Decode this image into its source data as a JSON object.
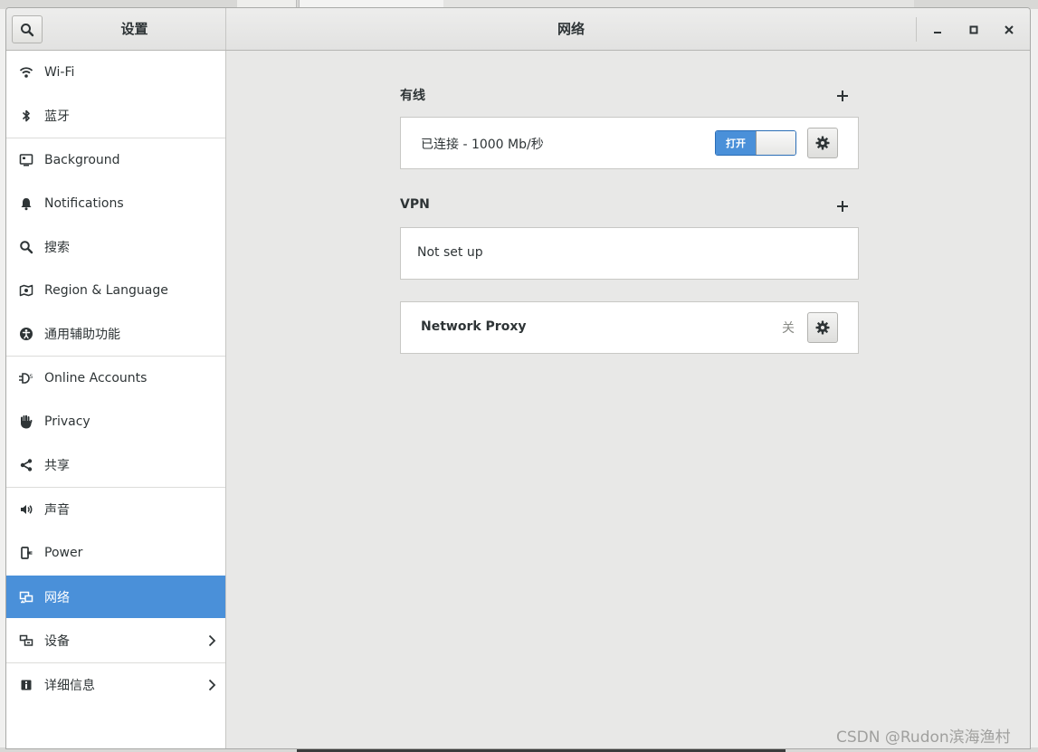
{
  "window": {
    "sidebar_title": "设置",
    "panel_title": "网络"
  },
  "sidebar": {
    "items": [
      {
        "label": "Wi-Fi",
        "icon": "wifi-icon"
      },
      {
        "label": "蓝牙",
        "icon": "bluetooth-icon"
      },
      {
        "label": "Background",
        "icon": "background-icon"
      },
      {
        "label": "Notifications",
        "icon": "bell-icon"
      },
      {
        "label": "搜索",
        "icon": "search-icon"
      },
      {
        "label": "Region & Language",
        "icon": "region-icon"
      },
      {
        "label": "通用辅助功能",
        "icon": "accessibility-icon"
      },
      {
        "label": "Online Accounts",
        "icon": "online-accounts-icon"
      },
      {
        "label": "Privacy",
        "icon": "hand-icon"
      },
      {
        "label": "共享",
        "icon": "share-icon"
      },
      {
        "label": "声音",
        "icon": "speaker-icon"
      },
      {
        "label": "Power",
        "icon": "power-plug-icon"
      },
      {
        "label": "网络",
        "icon": "network-icon",
        "selected": true
      },
      {
        "label": "设备",
        "icon": "devices-icon",
        "has_submenu": true
      },
      {
        "label": "详细信息",
        "icon": "info-icon",
        "has_submenu": true
      }
    ]
  },
  "wired": {
    "title": "有线",
    "status": "已连接 - 1000 Mb/秒",
    "toggle_label": "打开",
    "toggle_on": true
  },
  "vpn": {
    "title": "VPN",
    "empty_text": "Not set up"
  },
  "proxy": {
    "label": "Network Proxy",
    "state": "关"
  },
  "watermark": "CSDN @Rudon滨海渔村",
  "colors": {
    "accent": "#4a90d9",
    "sidebar_bg": "#ffffff",
    "content_bg": "#e8e8e7"
  }
}
